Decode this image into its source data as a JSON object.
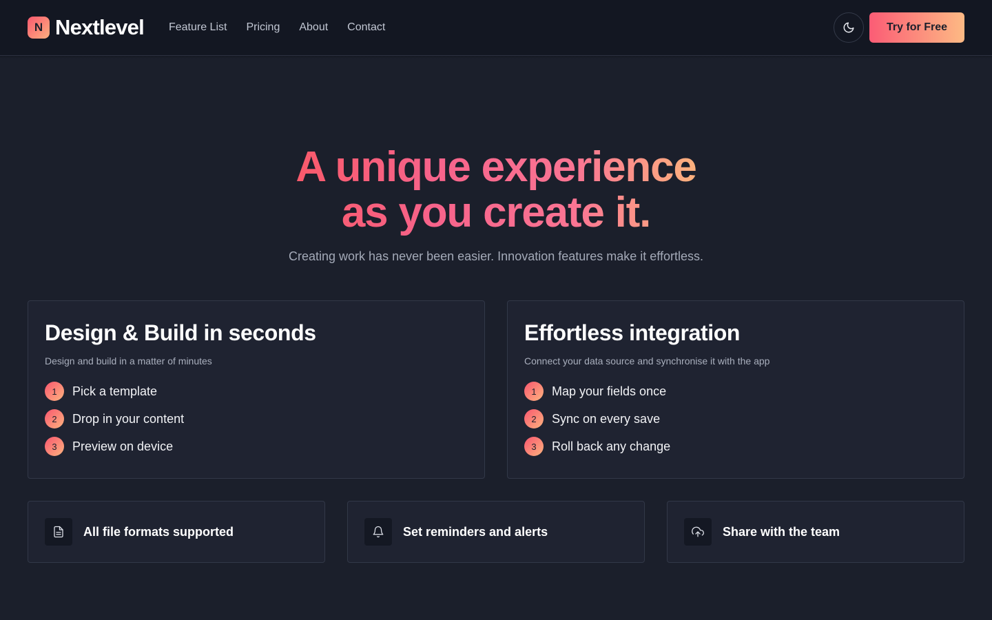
{
  "brand": {
    "logo_letter": "N",
    "name": "Nextlevel"
  },
  "nav": {
    "links": [
      "Feature List",
      "Pricing",
      "About",
      "Contact"
    ],
    "theme_icon": "moon-icon",
    "cta_label": "Try for Free"
  },
  "hero": {
    "title_line1": "A unique experience",
    "title_line2": "as you create it.",
    "subtitle": "Creating work has never been easier. Innovation features make it effortless."
  },
  "feature_cards": [
    {
      "title": "Design & Build in seconds",
      "subtitle": "Design and build in a matter of minutes",
      "steps": [
        {
          "num": "1",
          "label": "Pick a template"
        },
        {
          "num": "2",
          "label": "Drop in your content"
        },
        {
          "num": "3",
          "label": "Preview on device"
        }
      ]
    },
    {
      "title": "Effortless integration",
      "subtitle": "Connect your data source and synchronise it with the app",
      "steps": [
        {
          "num": "1",
          "label": "Map your fields once"
        },
        {
          "num": "2",
          "label": "Sync on every save"
        },
        {
          "num": "3",
          "label": "Roll back any change"
        }
      ]
    }
  ],
  "small_cards": [
    {
      "icon": "file-icon",
      "label": "All file formats supported"
    },
    {
      "icon": "bell-icon",
      "label": "Set reminders and alerts"
    },
    {
      "icon": "cloud-upload-icon",
      "label": "Share with the team"
    }
  ],
  "colors": {
    "accent_start": "#f9596f",
    "accent_end": "#fdb07f",
    "background": "#1b1f2b",
    "nav_bg": "#131722"
  }
}
